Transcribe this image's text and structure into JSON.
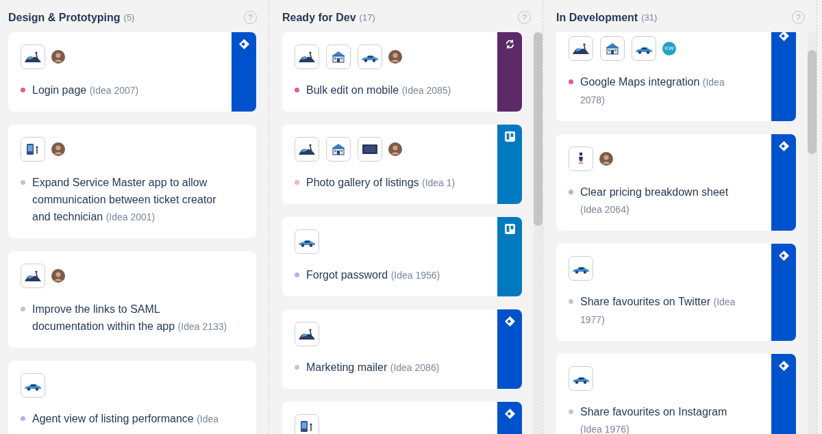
{
  "columns": [
    {
      "title": "Design & Prototyping",
      "count": "(5)",
      "help": "?",
      "scrollbar": false,
      "cards": [
        {
          "thumbnails": [
            {
              "kind": "hills"
            }
          ],
          "assignee": {
            "kind": "photo"
          },
          "color": "#e4589d",
          "title": "Login page",
          "idea": "(Idea 2007)",
          "integration": {
            "kind": "jira"
          }
        },
        {
          "thumbnails": [
            {
              "kind": "phone"
            }
          ],
          "assignee": {
            "kind": "photo"
          },
          "color": "#c6c6c6",
          "title": "Expand Service Master app to allow communication between ticket creator and technician",
          "idea": "(Idea 2001)"
        },
        {
          "thumbnails": [
            {
              "kind": "hills"
            }
          ],
          "assignee": {
            "kind": "photo"
          },
          "color": "#c6c6c6",
          "title": "Improve the links to SAML documentation within the app",
          "idea": "(Idea 2133)"
        },
        {
          "thumbnails": [
            {
              "kind": "car"
            }
          ],
          "color": "#c8a6ea",
          "title": "Agent view of listing performance",
          "idea": "(Idea"
        }
      ]
    },
    {
      "title": "Ready for Dev",
      "count": "(17)",
      "help": "?",
      "scrollbar": true,
      "cards": [
        {
          "thumbnails": [
            {
              "kind": "hills"
            },
            {
              "kind": "house"
            },
            {
              "kind": "car"
            }
          ],
          "assignee": {
            "kind": "photo"
          },
          "color": "#e4589d",
          "title": "Bulk edit on mobile",
          "idea": "(Idea 2085)",
          "integration": {
            "kind": "devops"
          }
        },
        {
          "thumbnails": [
            {
              "kind": "hills"
            },
            {
              "kind": "house"
            },
            {
              "kind": "screen"
            }
          ],
          "assignee": {
            "kind": "photo"
          },
          "color": "#efb1d2",
          "title": "Photo gallery of listings",
          "idea": "(Idea 1)",
          "integration": {
            "kind": "trello"
          }
        },
        {
          "thumbnails": [
            {
              "kind": "car"
            }
          ],
          "color": "#c8a6ea",
          "title": "Forgot password",
          "idea": "(Idea 1956)",
          "integration": {
            "kind": "trello"
          }
        },
        {
          "thumbnails": [
            {
              "kind": "hills"
            }
          ],
          "color": "#c6c6c6",
          "title": "Marketing mailer",
          "idea": "(Idea 2086)",
          "integration": {
            "kind": "jira"
          }
        },
        {
          "thumbnails": [
            {
              "kind": "phone"
            }
          ],
          "integration": {
            "kind": "jira"
          }
        }
      ]
    },
    {
      "title": "In Development",
      "count": "(31)",
      "help": "?",
      "scrollbar": true,
      "cards": [
        {
          "thumbnails": [
            {
              "kind": "hills"
            },
            {
              "kind": "house"
            },
            {
              "kind": "car"
            }
          ],
          "assignee": {
            "kind": "initials",
            "initials": "KW"
          },
          "color": "#e4589d",
          "title": "Google Maps integration",
          "idea": "(Idea 2078)",
          "integration": {
            "kind": "jira"
          }
        },
        {
          "thumbnails": [
            {
              "kind": "person"
            }
          ],
          "assignee": {
            "kind": "photo"
          },
          "color": "#c8a6ea",
          "title": "Clear pricing breakdown sheet",
          "idea": "(Idea 2064)",
          "integration": {
            "kind": "jira"
          }
        },
        {
          "thumbnails": [
            {
              "kind": "car"
            }
          ],
          "color": "#c6c6c6",
          "title": "Share favourites on Twitter",
          "idea": "(Idea 1977)",
          "integration": {
            "kind": "jira"
          }
        },
        {
          "thumbnails": [
            {
              "kind": "car"
            }
          ],
          "color": "#c6c6c6",
          "title": "Share favourites on Instagram",
          "idea": "(Idea 1976)",
          "integration": {
            "kind": "jira"
          }
        }
      ]
    }
  ]
}
